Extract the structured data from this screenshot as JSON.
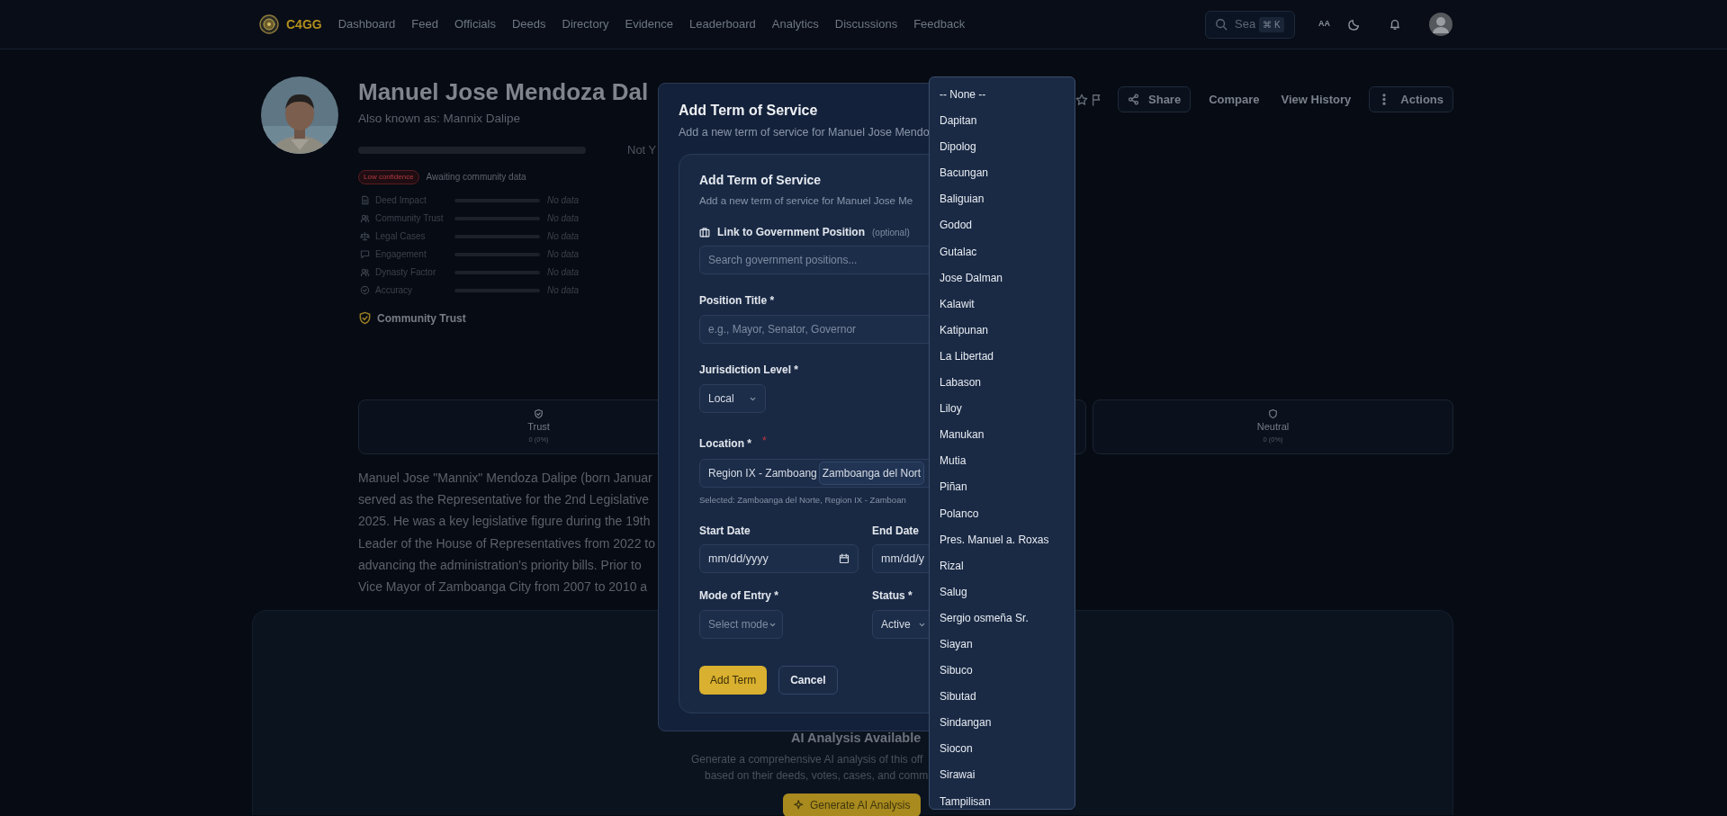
{
  "nav": {
    "brand": "C4GG",
    "links": [
      {
        "label": "Dashboard",
        "selected": false
      },
      {
        "label": "Feed",
        "selected": false
      },
      {
        "label": "Officials",
        "selected": false
      },
      {
        "label": "Deeds",
        "selected": false
      },
      {
        "label": "Directory",
        "selected": false
      },
      {
        "label": "Evidence",
        "selected": false
      },
      {
        "label": "Leaderboard",
        "selected": false
      },
      {
        "label": "Analytics",
        "selected": false
      },
      {
        "label": "Discussions",
        "selected": false
      },
      {
        "label": "Feedback",
        "selected": false
      }
    ],
    "search": {
      "placeholder": "Sea",
      "shortcut": "⌘ K"
    },
    "text_size": "AA"
  },
  "profile": {
    "name": "Manuel Jose Mendoza Dal",
    "aka": "Also known as: Mannix Dalipe",
    "score": {
      "level": 0,
      "label": "Not Y"
    },
    "confidence": "Low confidence",
    "confidence_note": "Awaiting community data",
    "metrics": [
      {
        "label": "Deed Impact",
        "value": "No data",
        "level": 0
      },
      {
        "label": "Community Trust",
        "value": "No data",
        "level": 0
      },
      {
        "label": "Legal Cases",
        "value": "No data",
        "level": 0
      },
      {
        "label": "Engagement",
        "value": "No data",
        "level": 0
      },
      {
        "label": "Dynasty Factor",
        "value": "No data",
        "level": 0
      },
      {
        "label": "Accuracy",
        "value": "No data",
        "level": 0
      }
    ],
    "trust_heading": "Community Trust"
  },
  "actions": {
    "share": "Share",
    "compare": "Compare",
    "history": "View History",
    "more": "Actions"
  },
  "stats": [
    {
      "label": "Trust",
      "value": "0 (0%)"
    },
    {
      "label": "Neutral",
      "value": "0 (0%)"
    }
  ],
  "bio_lines": [
    "Manuel Jose \"Mannix\" Mendoza Dalipe (born Januar",
    "served as the Representative for the 2nd Legislative",
    "2025. He was a key legislative figure during the 19th",
    "Leader of the House of Representatives from 2022 to",
    "advancing the administration's priority bills. Prior to",
    "Vice Mayor of Zamboanga City from 2007 to 2010 a"
  ],
  "ai": {
    "title": "AI Analysis Available",
    "lines": [
      "Generate a comprehensive AI analysis of this off",
      "based on their deeds, votes, cases, and comm"
    ],
    "button": "Generate AI Analysis"
  },
  "modal": {
    "title": "Add Term of Service",
    "subtitle": "Add a new term of service for Manuel Jose Mendo",
    "form": {
      "title": "Add Term of Service",
      "subtitle": "Add a new term of service for Manuel Jose Me",
      "link_label": "Link to Government Position",
      "link_optional": "(optional)",
      "link_placeholder": "Search government positions...",
      "position_label": "Position Title *",
      "position_placeholder": "e.g., Mayor, Senator, Governor",
      "jurisdiction_label": "Jurisdiction Level *",
      "jurisdiction_value": "Local",
      "location_label": "Location *",
      "location_required": "*",
      "region_value": "Region IX - Zamboang",
      "province_value": "Zamboanga del Nort",
      "selected_note": "Selected: Zamboanga del Norte, Region IX - Zamboan",
      "start_label": "Start Date",
      "start_placeholder": "mm/dd/yyyy",
      "end_label": "End Date",
      "end_placeholder": "mm/dd/y",
      "mode_label": "Mode of Entry *",
      "mode_placeholder": "Select mode",
      "status_label": "Status *",
      "status_value": "Active",
      "submit": "Add Term",
      "cancel": "Cancel"
    }
  },
  "location_dropdown": {
    "options": [
      {
        "label": "-- None --",
        "selected": false
      },
      {
        "label": "Dapitan",
        "selected": false
      },
      {
        "label": "Dipolog",
        "selected": false
      },
      {
        "label": "Bacungan",
        "selected": false
      },
      {
        "label": "Baliguian",
        "selected": false
      },
      {
        "label": "Godod",
        "selected": false
      },
      {
        "label": "Gutalac",
        "selected": false
      },
      {
        "label": "Jose Dalman",
        "selected": false
      },
      {
        "label": "Kalawit",
        "selected": false
      },
      {
        "label": "Katipunan",
        "selected": false
      },
      {
        "label": "La Libertad",
        "selected": false
      },
      {
        "label": "Labason",
        "selected": false
      },
      {
        "label": "Liloy",
        "selected": false
      },
      {
        "label": "Manukan",
        "selected": false
      },
      {
        "label": "Mutia",
        "selected": false
      },
      {
        "label": "Piñan",
        "selected": false
      },
      {
        "label": "Polanco",
        "selected": false
      },
      {
        "label": "Pres. Manuel a. Roxas",
        "selected": false
      },
      {
        "label": "Rizal",
        "selected": false
      },
      {
        "label": "Salug",
        "selected": false
      },
      {
        "label": "Sergio osmeña Sr.",
        "selected": false
      },
      {
        "label": "Siayan",
        "selected": false
      },
      {
        "label": "Sibuco",
        "selected": false
      },
      {
        "label": "Sibutad",
        "selected": false
      },
      {
        "label": "Sindangan",
        "selected": false
      },
      {
        "label": "Siocon",
        "selected": false
      },
      {
        "label": "Sirawai",
        "selected": false
      },
      {
        "label": "Tampilisan",
        "selected": false
      }
    ]
  }
}
